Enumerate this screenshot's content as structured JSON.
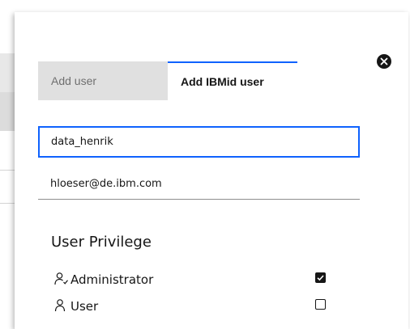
{
  "background": {
    "color": "#e8e8e8"
  },
  "modal": {
    "close_icon": "close-icon",
    "tabs": [
      {
        "label": "Add user",
        "selected": false
      },
      {
        "label": "Add IBMid user",
        "selected": true
      }
    ],
    "username_field": {
      "value": "data_henrik",
      "focused": true
    },
    "email_field": {
      "value": "hloeser@de.ibm.com"
    },
    "privileges": {
      "title": "User Privilege",
      "items": [
        {
          "label": "Administrator",
          "icon": "user-admin-icon",
          "checked": true
        },
        {
          "label": "User",
          "icon": "user-icon",
          "checked": false
        }
      ]
    },
    "accent_color": "#0f62fe"
  }
}
